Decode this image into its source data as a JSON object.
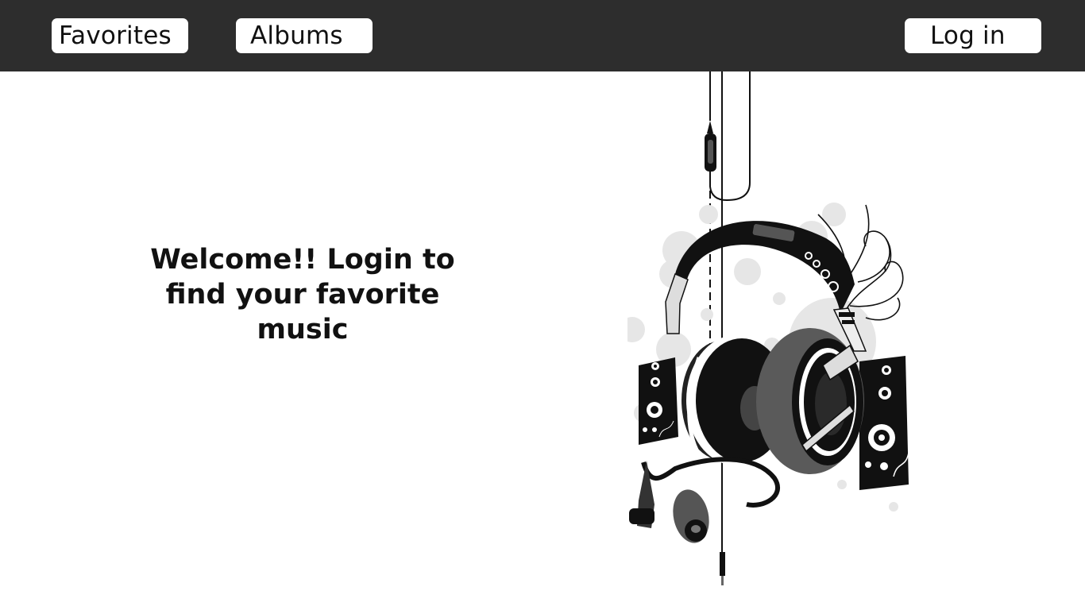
{
  "nav": {
    "favorites_label": "Favorites",
    "albums_label": "Albums",
    "login_label": "Log in"
  },
  "main": {
    "welcome_text": "Welcome!! Login to find your favorite music"
  },
  "hero": {
    "icon": "headphones-illustration"
  },
  "colors": {
    "topbar": "#2d2d2d",
    "button": "#ffffff",
    "text": "#111111"
  }
}
